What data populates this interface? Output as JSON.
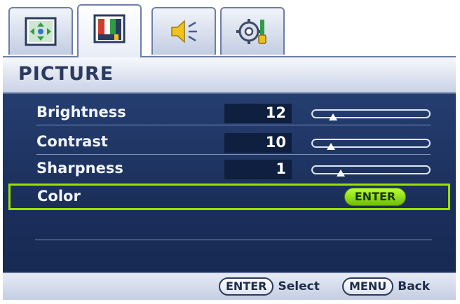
{
  "tabs": [
    {
      "name": "display",
      "icon": "display-adjust-icon",
      "active": false
    },
    {
      "name": "picture",
      "icon": "picture-icon",
      "active": true
    },
    {
      "name": "audio",
      "icon": "speaker-icon",
      "active": false
    },
    {
      "name": "system",
      "icon": "gear-settings-icon",
      "active": false
    }
  ],
  "title": "PICTURE",
  "settings": [
    {
      "label": "Brightness",
      "value": "12",
      "level": 0.12
    },
    {
      "label": "Contrast",
      "value": "10",
      "level": 0.1
    },
    {
      "label": "Sharpness",
      "value": "1",
      "level": 0.2
    }
  ],
  "color_item": {
    "label": "Color",
    "button": "ENTER"
  },
  "footer": {
    "enter_key": "ENTER",
    "enter_action": "Select",
    "menu_key": "MENU",
    "menu_action": "Back"
  },
  "colors": {
    "panel": "#1b2f5b",
    "selection": "#9be000",
    "title_text": "#2b3a5e"
  }
}
